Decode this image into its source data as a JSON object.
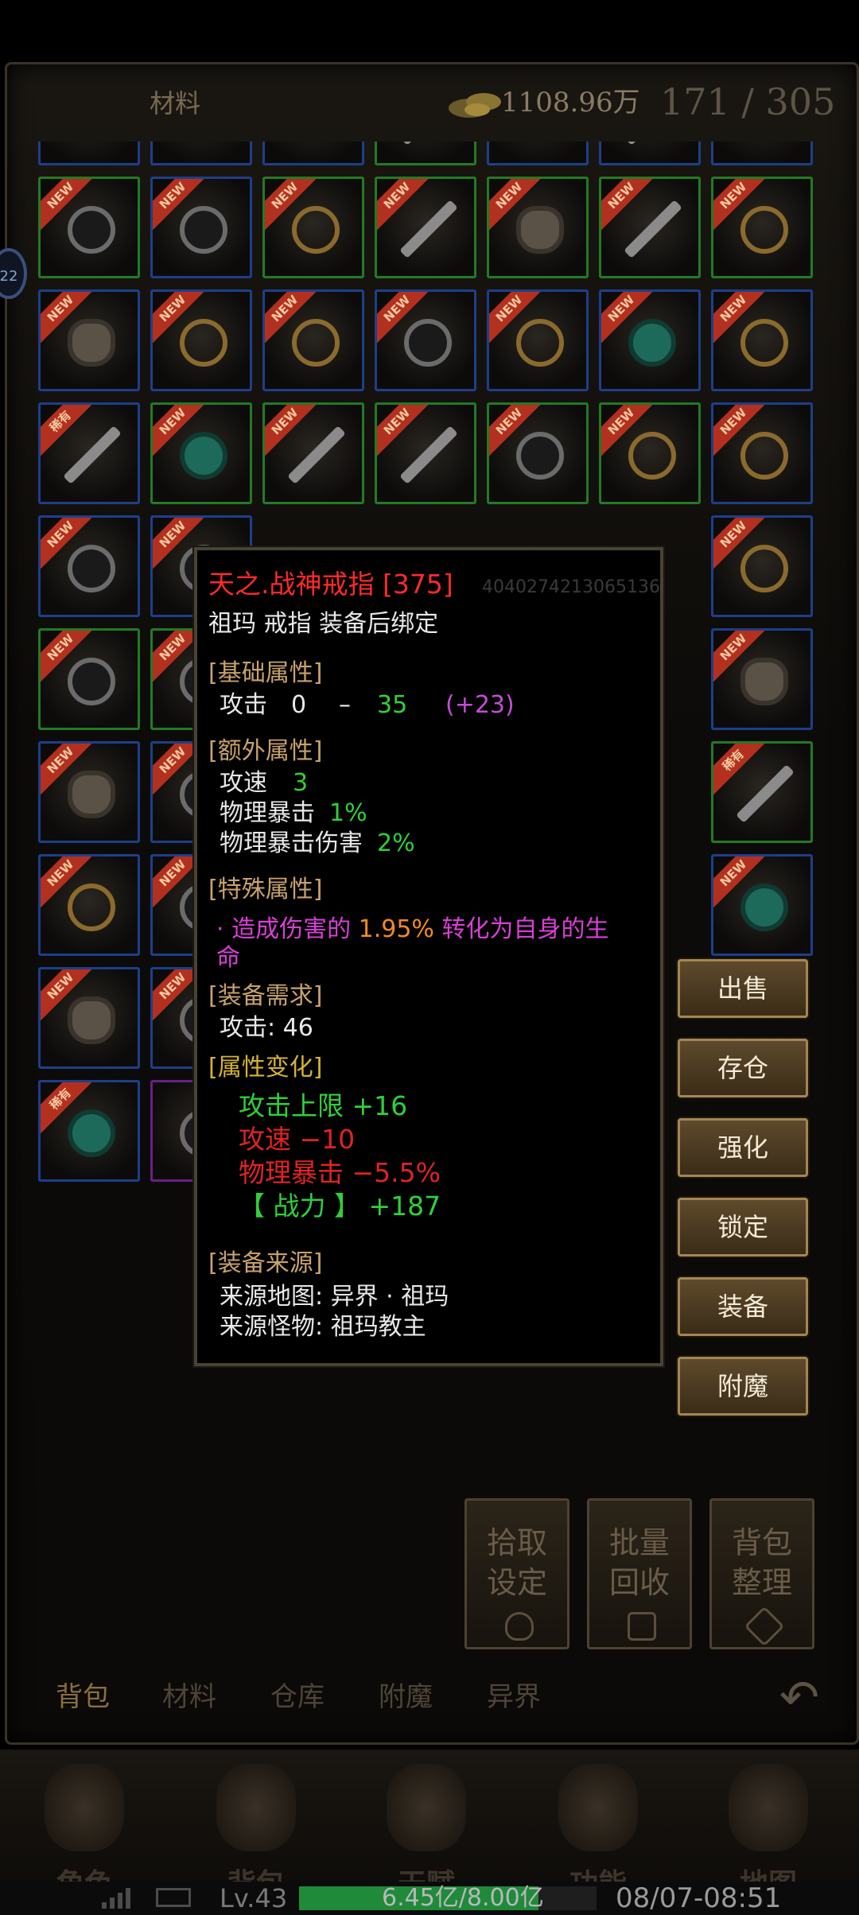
{
  "header": {
    "tab_label": "材料",
    "gold": "1108.96万",
    "capacity": "171 / 305"
  },
  "badges": {
    "new": "NEW",
    "rare": "稀有"
  },
  "float_button": {
    "label": "22"
  },
  "tooltip": {
    "name": "天之.战神戒指 [375]",
    "subtitle": "祖玛 戒指 装备后绑定",
    "overlap_text": "4040274213065136",
    "base_title": "[基础属性]",
    "atk_label": "攻击",
    "atk_min": "0",
    "atk_dash": "–",
    "atk_max": "35",
    "atk_bonus": "(+23)",
    "extra_title": "[额外属性]",
    "spd_label": "攻速",
    "spd_val": "3",
    "crit_label": "物理暴击",
    "crit_val": "1%",
    "critdmg_label": "物理暴击伤害",
    "critdmg_val": "2%",
    "special_title": "[特殊属性]",
    "special_a": "· 造成伤害的 ",
    "special_b": "1.95%",
    "special_c": " 转化为自身的生",
    "special_d": "命",
    "req_title": "[装备需求]",
    "req": "攻击: 46",
    "change_title": "[属性变化]",
    "chg1": "攻击上限 +16",
    "chg2": "攻速 −10",
    "chg3": "物理暴击 −5.5%",
    "chg4": "【 战力 】 +187",
    "source_title": "[装备来源]",
    "src_map": "来源地图:  异界 · 祖玛",
    "src_mob": "来源怪物:  祖玛教主"
  },
  "actions": [
    "出售",
    "存仓",
    "强化",
    "锁定",
    "装备",
    "附魔"
  ],
  "tools": [
    {
      "l1": "拾取",
      "l2": "设定"
    },
    {
      "l1": "批量",
      "l2": "回收"
    },
    {
      "l1": "背包",
      "l2": "整理"
    }
  ],
  "tabs": [
    "背包",
    "材料",
    "仓库",
    "附魔",
    "异界"
  ],
  "nav": [
    "角色",
    "背包",
    "天赋",
    "功能",
    "地图"
  ],
  "status": {
    "level": "Lv.43",
    "exp_text": "6.45亿/8.00亿",
    "exp_fraction": 0.806,
    "clock": "08/07-08:51"
  }
}
